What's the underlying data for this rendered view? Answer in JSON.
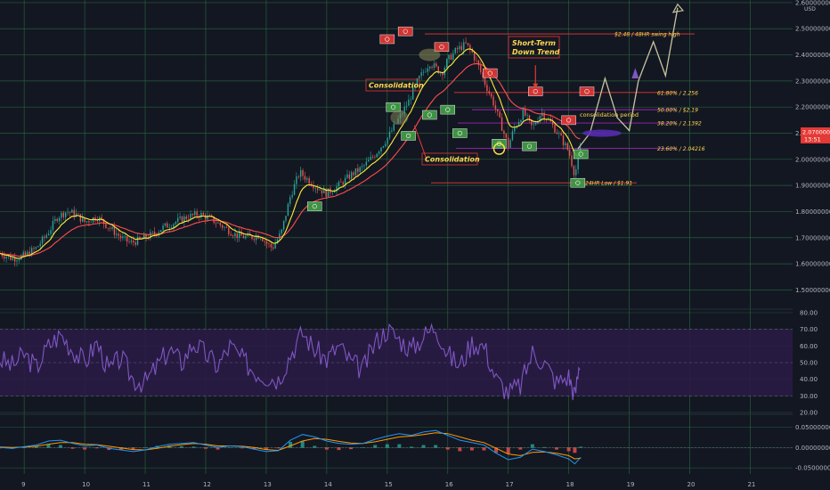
{
  "chart_data": [
    {
      "type": "candlestick",
      "price_currency": "USD",
      "y_ticks": [
        "2.60000000",
        "2.50000000",
        "2.40000000",
        "2.30000000",
        "2.20000000",
        "2.10000000",
        "2.00000000",
        "1.90000000",
        "1.80000000",
        "1.70000000",
        "1.60000000",
        "1.50000000"
      ],
      "ylim": [
        1.44,
        2.61
      ],
      "x_ticks": [
        "9",
        "10",
        "11",
        "12",
        "13",
        "14",
        "15",
        "16",
        "17",
        "18",
        "19",
        "20",
        "21"
      ],
      "xlim": [
        8.6,
        21.7
      ],
      "current_price": "2.07000000",
      "countdown": "13:51",
      "close_path": [
        [
          8.6,
          1.64
        ],
        [
          8.8,
          1.62
        ],
        [
          9.0,
          1.63
        ],
        [
          9.2,
          1.66
        ],
        [
          9.4,
          1.72
        ],
        [
          9.55,
          1.78
        ],
        [
          9.7,
          1.8
        ],
        [
          9.85,
          1.79
        ],
        [
          10.0,
          1.76
        ],
        [
          10.2,
          1.78
        ],
        [
          10.4,
          1.74
        ],
        [
          10.6,
          1.7
        ],
        [
          10.75,
          1.68
        ],
        [
          10.9,
          1.69
        ],
        [
          11.1,
          1.71
        ],
        [
          11.3,
          1.74
        ],
        [
          11.5,
          1.76
        ],
        [
          11.7,
          1.78
        ],
        [
          11.9,
          1.79
        ],
        [
          12.1,
          1.77
        ],
        [
          12.3,
          1.74
        ],
        [
          12.5,
          1.71
        ],
        [
          12.7,
          1.7
        ],
        [
          12.9,
          1.71
        ],
        [
          13.0,
          1.68
        ],
        [
          13.1,
          1.66
        ],
        [
          13.25,
          1.72
        ],
        [
          13.4,
          1.86
        ],
        [
          13.55,
          1.95
        ],
        [
          13.7,
          1.92
        ],
        [
          13.85,
          1.89
        ],
        [
          14.0,
          1.87
        ],
        [
          14.2,
          1.9
        ],
        [
          14.4,
          1.94
        ],
        [
          14.6,
          1.97
        ],
        [
          14.8,
          2.02
        ],
        [
          15.0,
          2.08
        ],
        [
          15.2,
          2.16
        ],
        [
          15.35,
          2.22
        ],
        [
          15.5,
          2.3
        ],
        [
          15.7,
          2.37
        ],
        [
          15.9,
          2.33
        ],
        [
          16.0,
          2.38
        ],
        [
          16.15,
          2.42
        ],
        [
          16.3,
          2.44
        ],
        [
          16.4,
          2.41
        ],
        [
          16.5,
          2.36
        ],
        [
          16.6,
          2.3
        ],
        [
          16.75,
          2.22
        ],
        [
          16.9,
          2.12
        ],
        [
          17.0,
          2.05
        ],
        [
          17.1,
          2.12
        ],
        [
          17.25,
          2.18
        ],
        [
          17.4,
          2.12
        ],
        [
          17.55,
          2.18
        ],
        [
          17.7,
          2.14
        ],
        [
          17.85,
          2.09
        ],
        [
          18.0,
          2.03
        ],
        [
          18.1,
          1.94
        ],
        [
          18.2,
          2.05
        ]
      ],
      "levels": [
        {
          "label": "$2.48 / 48HR swing high",
          "value": 2.48
        },
        {
          "label": "61.80% / 2.256",
          "value": 2.256
        },
        {
          "label": "50.00% / $2.19",
          "value": 2.19
        },
        {
          "label": "38.20% / 2.1392",
          "value": 2.1392
        },
        {
          "label": "23.60% / 2.04216",
          "value": 2.04216
        },
        {
          "label": "24HR Low / $1.91",
          "value": 1.91
        }
      ],
      "annotations": [
        "Short-Term",
        "Down Trend",
        "Consolidation",
        "Consolidation",
        "consolidation period"
      ],
      "projection": [
        [
          18.15,
          2.04
        ],
        [
          18.35,
          2.1
        ],
        [
          18.6,
          2.31
        ],
        [
          18.8,
          2.16
        ],
        [
          19.0,
          2.11
        ],
        [
          19.15,
          2.3
        ],
        [
          19.4,
          2.45
        ],
        [
          19.6,
          2.32
        ],
        [
          19.8,
          2.58
        ]
      ]
    },
    {
      "type": "line",
      "indicator": "RSI",
      "y_ticks": [
        "80.00",
        "70.00",
        "60.00",
        "50.00",
        "40.00",
        "30.00",
        "20.00"
      ],
      "ylim": [
        20,
        80
      ],
      "band": [
        30,
        70
      ],
      "x": [
        8.6,
        8.8,
        9.0,
        9.2,
        9.4,
        9.6,
        9.8,
        10.0,
        10.2,
        10.4,
        10.6,
        10.8,
        11.0,
        11.2,
        11.4,
        11.6,
        11.8,
        12.0,
        12.2,
        12.4,
        12.6,
        12.8,
        13.0,
        13.2,
        13.4,
        13.6,
        13.8,
        14.0,
        14.2,
        14.4,
        14.6,
        14.8,
        15.0,
        15.2,
        15.4,
        15.6,
        15.8,
        16.0,
        16.2,
        16.4,
        16.6,
        16.8,
        17.0,
        17.2,
        17.4,
        17.6,
        17.8,
        18.0,
        18.1,
        18.2
      ],
      "values": [
        52,
        48,
        55,
        47,
        60,
        67,
        58,
        50,
        62,
        45,
        53,
        40,
        38,
        48,
        58,
        50,
        62,
        55,
        48,
        60,
        52,
        45,
        42,
        40,
        55,
        68,
        58,
        52,
        60,
        50,
        46,
        62,
        70,
        64,
        58,
        66,
        72,
        55,
        48,
        62,
        60,
        40,
        32,
        36,
        56,
        50,
        38,
        42,
        30,
        54
      ]
    },
    {
      "type": "line",
      "indicator": "MACD",
      "y_ticks": [
        "0.05000000",
        "0.00000000",
        "-0.05000000"
      ],
      "ylim": [
        -0.065,
        0.075
      ],
      "x": [
        8.6,
        8.8,
        9.0,
        9.2,
        9.4,
        9.6,
        9.8,
        10.0,
        10.2,
        10.4,
        10.6,
        10.8,
        11.0,
        11.2,
        11.4,
        11.6,
        11.8,
        12.0,
        12.2,
        12.4,
        12.6,
        12.8,
        13.0,
        13.2,
        13.4,
        13.6,
        13.8,
        14.0,
        14.2,
        14.4,
        14.6,
        14.8,
        15.0,
        15.2,
        15.4,
        15.6,
        15.8,
        16.0,
        16.2,
        16.4,
        16.6,
        16.8,
        17.0,
        17.2,
        17.4,
        17.6,
        17.8,
        18.0,
        18.1,
        18.2
      ],
      "macd": [
        0.0,
        -0.002,
        0.002,
        0.006,
        0.016,
        0.018,
        0.01,
        0.004,
        0.006,
        -0.002,
        -0.006,
        -0.01,
        -0.006,
        0.002,
        0.008,
        0.01,
        0.012,
        0.006,
        0.0,
        0.004,
        0.002,
        -0.004,
        -0.01,
        -0.008,
        0.018,
        0.032,
        0.026,
        0.016,
        0.01,
        0.008,
        0.01,
        0.02,
        0.028,
        0.034,
        0.03,
        0.038,
        0.042,
        0.03,
        0.018,
        0.012,
        0.006,
        -0.014,
        -0.03,
        -0.024,
        -0.004,
        -0.01,
        -0.018,
        -0.028,
        -0.04,
        -0.024
      ],
      "signal": [
        0.001,
        0.0,
        0.001,
        0.003,
        0.008,
        0.012,
        0.012,
        0.008,
        0.007,
        0.003,
        -0.001,
        -0.005,
        -0.006,
        -0.002,
        0.003,
        0.007,
        0.01,
        0.008,
        0.004,
        0.004,
        0.003,
        0.0,
        -0.005,
        -0.007,
        0.004,
        0.016,
        0.022,
        0.02,
        0.015,
        0.011,
        0.01,
        0.014,
        0.02,
        0.026,
        0.028,
        0.032,
        0.036,
        0.034,
        0.026,
        0.018,
        0.012,
        -0.002,
        -0.016,
        -0.02,
        -0.012,
        -0.011,
        -0.014,
        -0.02,
        -0.028,
        -0.026
      ]
    }
  ],
  "colors": {
    "background": "#131722",
    "grid": "#2a6e3f",
    "up": "#26a69a",
    "down": "#ef5350",
    "ema_fast": "#ffeb3b",
    "ema_slow": "#ff4d4d",
    "rsi": "#7e57c2",
    "rsi_band": "#2a1b45",
    "macd": "#2196f3",
    "signal": "#ff9800",
    "level_line": "#e53935",
    "fib_line": "#9c27b0",
    "annotation": "#ffd84d",
    "price_badge": "#e53935"
  }
}
